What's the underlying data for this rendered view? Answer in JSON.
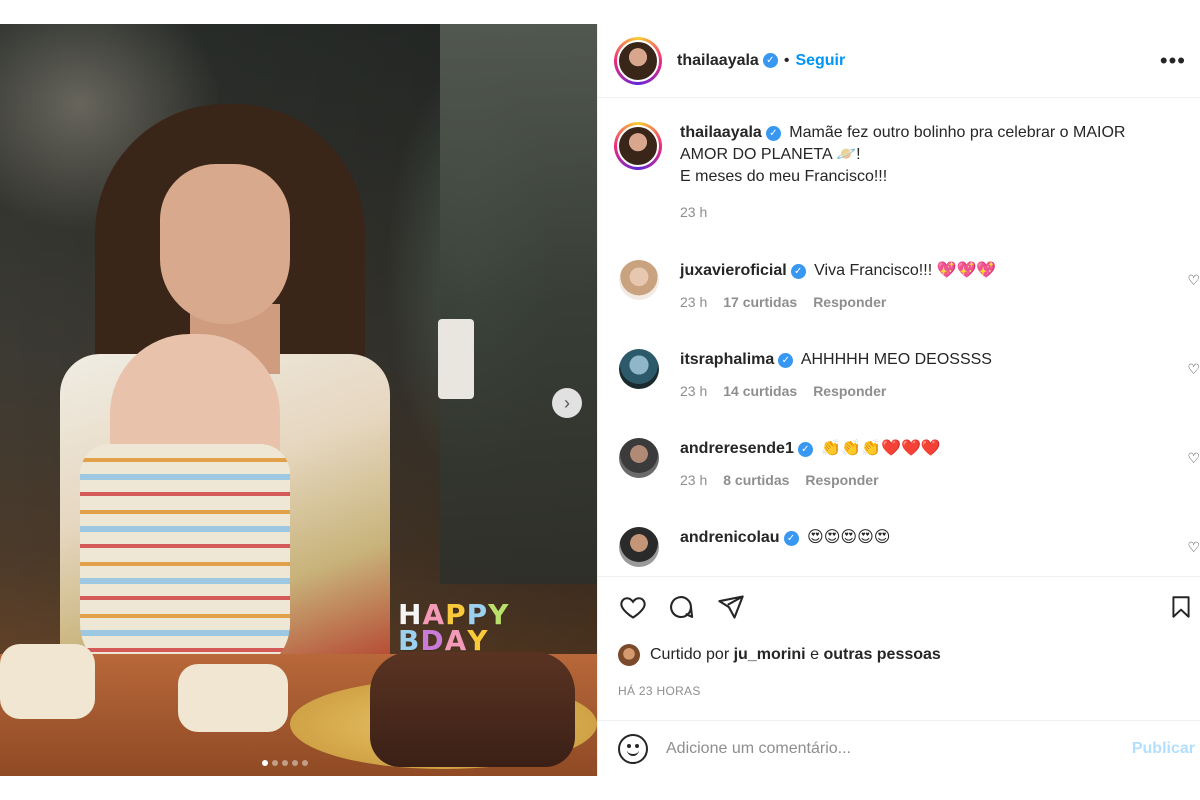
{
  "post": {
    "username": "thailaayala",
    "follow_label": "Seguir",
    "separator": "•",
    "more_label": "•••",
    "carousel_dots": 5
  },
  "photo": {
    "candle_letters": [
      "H",
      "A",
      "P",
      "P",
      "Y",
      "B",
      "D",
      "A",
      "Y"
    ],
    "candle_colors": [
      "#f5f5f5",
      "#f29ab8",
      "#f7c93b",
      "#9bd0ef",
      "#b8e06a",
      "#9bd0ef",
      "#c97bd8",
      "#f29ab8",
      "#f7c93b"
    ]
  },
  "caption": {
    "username": "thailaayala",
    "text_line1": "Mamãe fez outro bolinho pra celebrar o MAIOR",
    "text_line2": "AMOR DO PLANETA 🪐!",
    "text_line3": "E meses do meu Francisco!!!",
    "time": "23 h"
  },
  "comments": [
    {
      "username": "juxavieroficial",
      "text": "Viva Francisco!!! 💖💖💖",
      "time": "23 h",
      "likes": "17 curtidas",
      "reply": "Responder"
    },
    {
      "username": "itsraphalima",
      "text": "AHHHHH MEO DEOSSSS",
      "time": "23 h",
      "likes": "14 curtidas",
      "reply": "Responder"
    },
    {
      "username": "andreresende1",
      "text": "👏👏👏❤️❤️❤️",
      "time": "23 h",
      "likes": "8 curtidas",
      "reply": "Responder"
    },
    {
      "username": "andrenicolau",
      "text": "😍😍😍😍😍",
      "time": "",
      "likes": "",
      "reply": ""
    }
  ],
  "likes_line": {
    "prefix": "Curtido por",
    "user": "ju_morini",
    "conj": "e",
    "others": "outras pessoas"
  },
  "time_ago": "HÁ 23 HORAS",
  "add_comment": {
    "placeholder": "Adicione um comentário...",
    "publish_label": "Publicar"
  },
  "colors": {
    "accent": "#0095f6",
    "publish_disabled": "#b2dffc",
    "verified": "#3897f0",
    "muted": "#8e8e8e",
    "text": "#262626"
  }
}
